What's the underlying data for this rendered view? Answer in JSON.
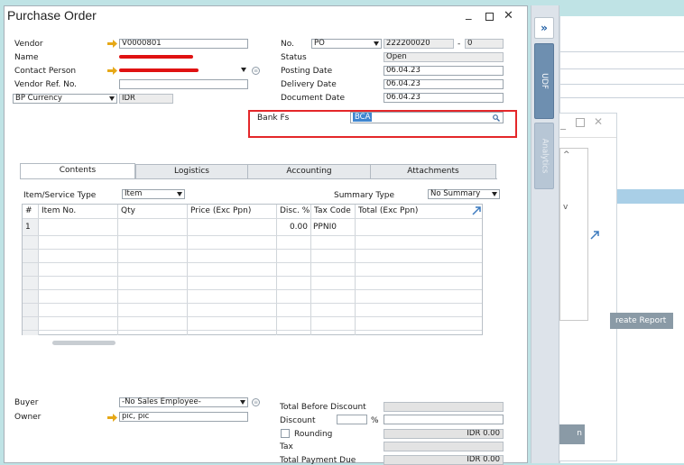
{
  "window": {
    "title": "Purchase Order"
  },
  "header_left": {
    "vendor": {
      "label": "Vendor",
      "value": "V0000801"
    },
    "name": {
      "label": "Name"
    },
    "contact_person": {
      "label": "Contact Person"
    },
    "vendor_ref": {
      "label": "Vendor Ref. No.",
      "value": ""
    },
    "bp_currency": {
      "label": "BP Currency",
      "value": "IDR"
    }
  },
  "header_right": {
    "no": {
      "label": "No.",
      "series": "PO",
      "value": "222200020",
      "sep": "-",
      "suffix": "0"
    },
    "status": {
      "label": "Status",
      "value": "Open"
    },
    "posting_date": {
      "label": "Posting Date",
      "value": "06.04.23"
    },
    "delivery_date": {
      "label": "Delivery Date",
      "value": "06.04.23"
    },
    "document_date": {
      "label": "Document Date",
      "value": "06.04.23"
    }
  },
  "udf": {
    "bank_fs": {
      "label": "Bank Fs",
      "value": "BCA"
    }
  },
  "tabs": [
    {
      "label": "Contents"
    },
    {
      "label": "Logistics"
    },
    {
      "label": "Accounting"
    },
    {
      "label": "Attachments"
    }
  ],
  "contents": {
    "item_service_type": {
      "label": "Item/Service Type",
      "value": "Item"
    },
    "summary_type": {
      "label": "Summary Type",
      "value": "No Summary"
    },
    "columns": [
      "#",
      "Item No.",
      "Qty",
      "Price (Exc Ppn)",
      "Disc. %",
      "Tax Code",
      "Total (Exc Ppn)"
    ],
    "rows": [
      {
        "num": "1",
        "item_no": "",
        "qty": "",
        "price": "",
        "disc": "0.00",
        "tax_code": "PPNI0",
        "total": ""
      }
    ]
  },
  "footer_left": {
    "buyer": {
      "label": "Buyer",
      "value": "-No Sales Employee-"
    },
    "owner": {
      "label": "Owner",
      "value": "pic, pic"
    }
  },
  "footer_right": {
    "total_before_discount": {
      "label": "Total Before Discount",
      "value": ""
    },
    "discount": {
      "label": "Discount",
      "value": "",
      "percent_sign": "%"
    },
    "rounding": {
      "label": "Rounding",
      "value": "IDR 0.00"
    },
    "tax": {
      "label": "Tax",
      "value": ""
    },
    "total_payment_due": {
      "label": "Total Payment Due",
      "value": "IDR 0.00"
    }
  },
  "sidebar": {
    "expand": "»",
    "udf": "UDF",
    "analytics": "Analytics"
  },
  "background": {
    "report_button": "reate Report",
    "button_partial": "n"
  },
  "colors": {
    "highlight_border": "#e4272a",
    "link_arrow": "#e6a817",
    "redaction": "#e01212",
    "selection": "#3f86d0",
    "udf_tab": "#6e8fb0"
  }
}
